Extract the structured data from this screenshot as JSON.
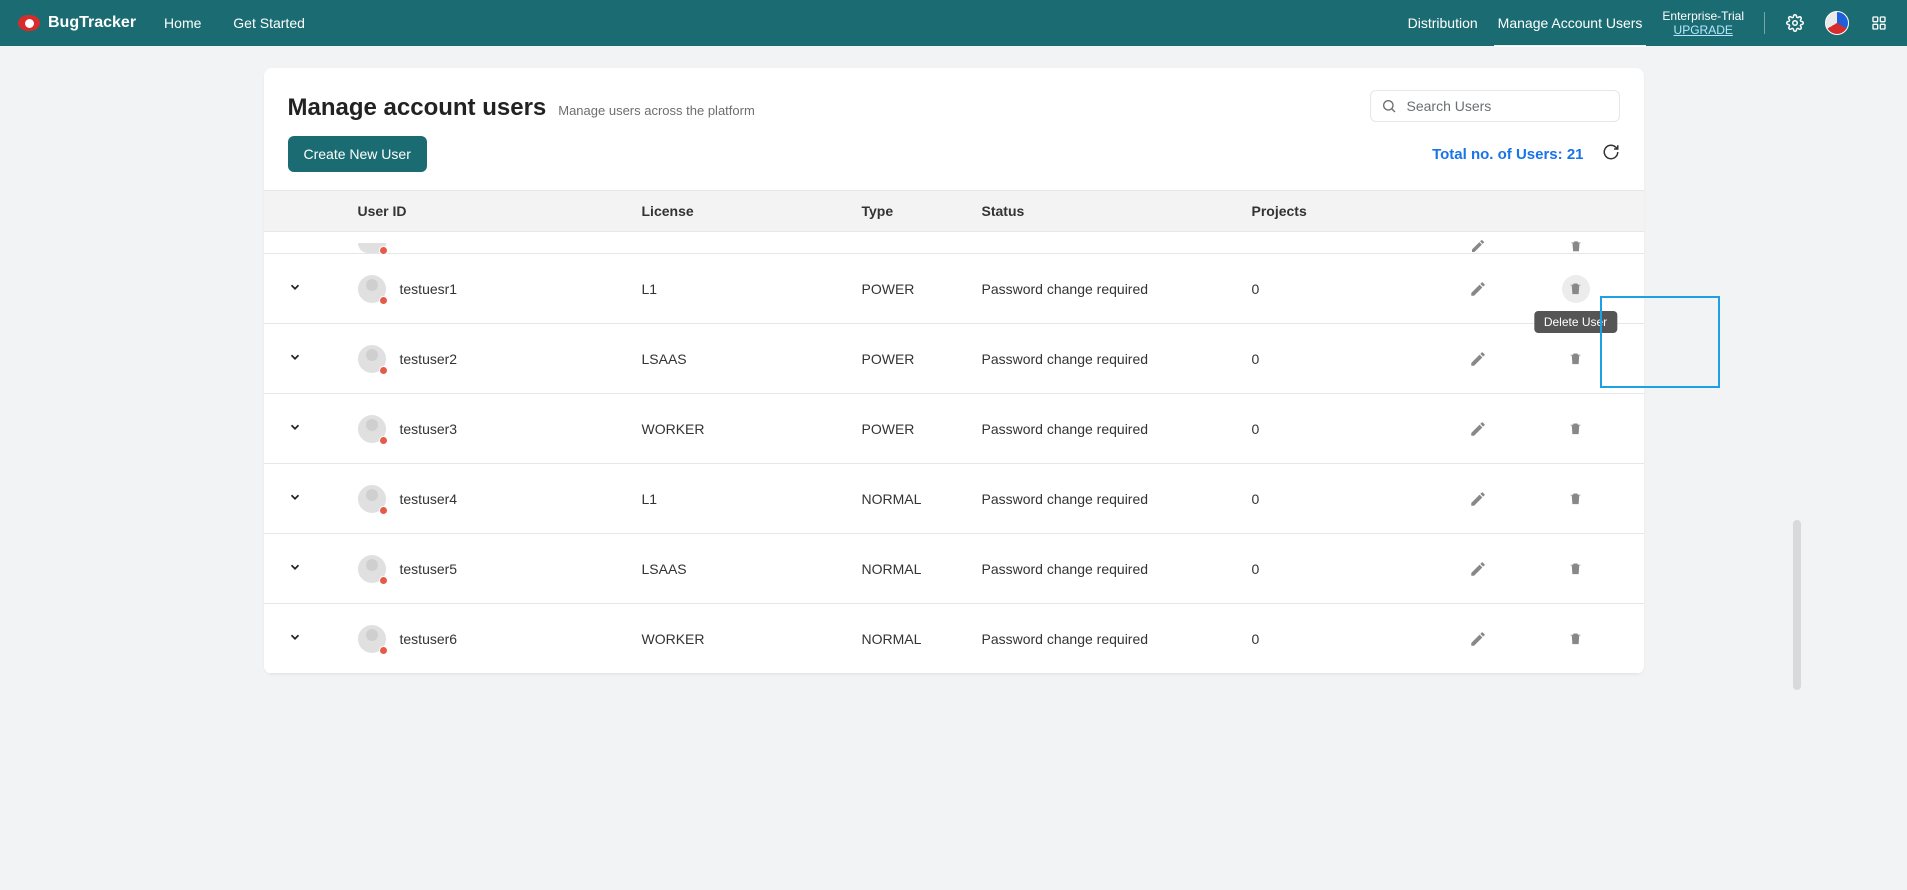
{
  "brand": "BugTracker",
  "nav": {
    "home": "Home",
    "get_started": "Get Started",
    "distribution": "Distribution",
    "manage_users": "Manage Account Users",
    "plan_name": "Enterprise-Trial",
    "upgrade": "UPGRADE"
  },
  "page": {
    "title": "Manage account users",
    "subtitle": "Manage users across the platform",
    "search_placeholder": "Search Users",
    "create_button": "Create New User",
    "total_label": "Total no. of Users: ",
    "total_count": "21"
  },
  "columns": {
    "user_id": "User ID",
    "license": "License",
    "type": "Type",
    "status": "Status",
    "projects": "Projects"
  },
  "tooltip_delete": "Delete User",
  "rows": [
    {
      "user": "testuesr1",
      "license": "L1",
      "type": "POWER",
      "status": "Password change required",
      "projects": "0",
      "highlighted": true
    },
    {
      "user": "testuser2",
      "license": "LSAAS",
      "type": "POWER",
      "status": "Password change required",
      "projects": "0"
    },
    {
      "user": "testuser3",
      "license": "WORKER",
      "type": "POWER",
      "status": "Password change required",
      "projects": "0"
    },
    {
      "user": "testuser4",
      "license": "L1",
      "type": "NORMAL",
      "status": "Password change required",
      "projects": "0"
    },
    {
      "user": "testuser5",
      "license": "LSAAS",
      "type": "NORMAL",
      "status": "Password change required",
      "projects": "0"
    },
    {
      "user": "testuser6",
      "license": "WORKER",
      "type": "NORMAL",
      "status": "Password change required",
      "projects": "0"
    }
  ]
}
